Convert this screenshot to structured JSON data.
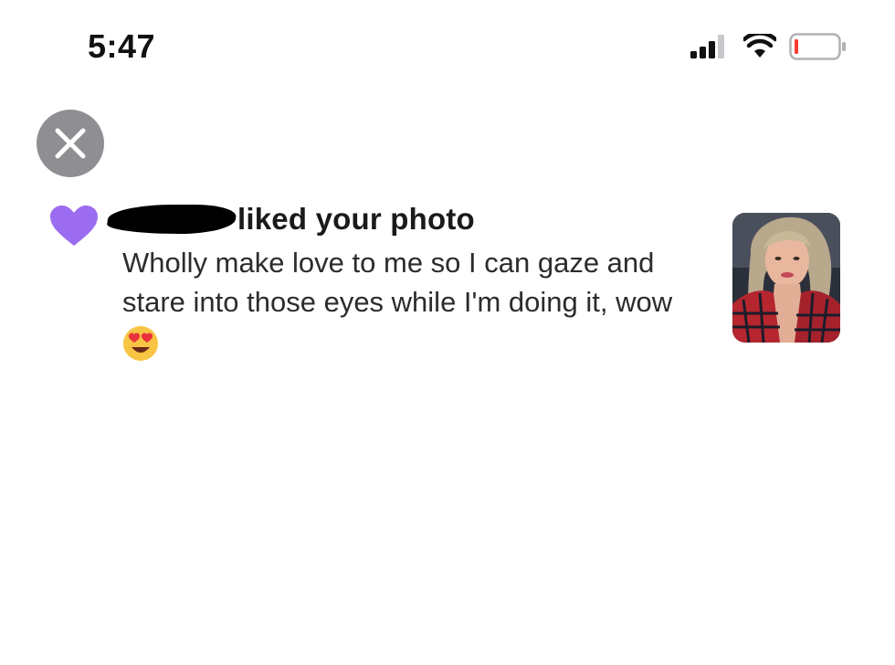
{
  "status_bar": {
    "time": "5:47",
    "signal_icon": "cellular-signal-icon",
    "wifi_icon": "wifi-icon",
    "battery_icon": "battery-low-icon",
    "battery_color": "#ff3b30"
  },
  "close_button": {
    "icon": "close-icon",
    "color": "#8e8e93"
  },
  "notification": {
    "icon": "heart-icon",
    "icon_color": "#9b6cf0",
    "action_text": "liked your photo",
    "message": "Wholly make love to me so I can gaze and stare into those eyes while I'm doing it, wow",
    "emoji": "😍",
    "thumbnail_icon": "photo-thumbnail"
  }
}
